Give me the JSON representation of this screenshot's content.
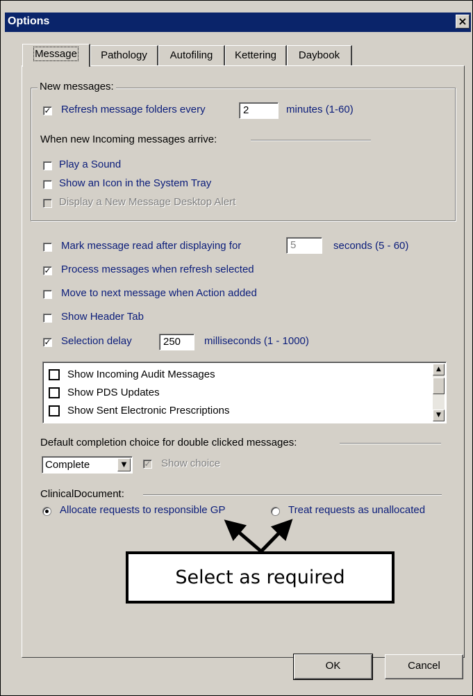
{
  "window": {
    "title": "Options"
  },
  "tabs": [
    {
      "label": "Message",
      "active": true
    },
    {
      "label": "Pathology"
    },
    {
      "label": "Autofiling"
    },
    {
      "label": "Kettering"
    },
    {
      "label": "Daybook"
    }
  ],
  "new_messages": {
    "group_label": "New messages:",
    "refresh": {
      "label": "Refresh message folders every",
      "checked": true,
      "value": "2",
      "suffix": "minutes (1-60)"
    },
    "arrive_label": "When new Incoming messages arrive:",
    "play_sound": {
      "label": "Play a Sound",
      "checked": false
    },
    "show_icon": {
      "label": "Show an Icon in the System Tray",
      "checked": false
    },
    "desktop_alert": {
      "label": "Display a New Message Desktop Alert",
      "checked": false,
      "disabled": true
    }
  },
  "options": {
    "mark_read": {
      "label": "Mark message read after displaying for",
      "checked": false,
      "value": "5",
      "suffix": "seconds (5 - 60)"
    },
    "process": {
      "label": "Process messages when refresh selected",
      "checked": true
    },
    "move_next": {
      "label": "Move to next message when Action added",
      "checked": false
    },
    "header_tab": {
      "label": "Show Header Tab",
      "checked": false
    },
    "selection_delay": {
      "label": "Selection delay",
      "checked": true,
      "value": "250",
      "suffix": "milliseconds (1 - 1000)"
    }
  },
  "list": {
    "items": [
      {
        "label": "Show Incoming Audit Messages",
        "checked": false
      },
      {
        "label": "Show PDS Updates",
        "checked": false
      },
      {
        "label": "Show Sent Electronic Prescriptions",
        "checked": false
      }
    ]
  },
  "completion": {
    "label": "Default completion choice for double clicked messages:",
    "value": "Complete",
    "show_choice": {
      "label": "Show choice",
      "checked": true,
      "disabled": true
    }
  },
  "clinical": {
    "label": "ClinicalDocument:",
    "allocate": {
      "label": "Allocate requests to responsible GP",
      "selected": true
    },
    "unallocated": {
      "label": "Treat requests as unallocated",
      "selected": false
    }
  },
  "annotation": {
    "text": "Select as required"
  },
  "buttons": {
    "ok": "OK",
    "cancel": "Cancel"
  },
  "icons": {
    "close": "close-icon",
    "check": "checkmark-icon",
    "arrow_up": "scroll-up-icon",
    "arrow_down": "scroll-down-icon"
  }
}
